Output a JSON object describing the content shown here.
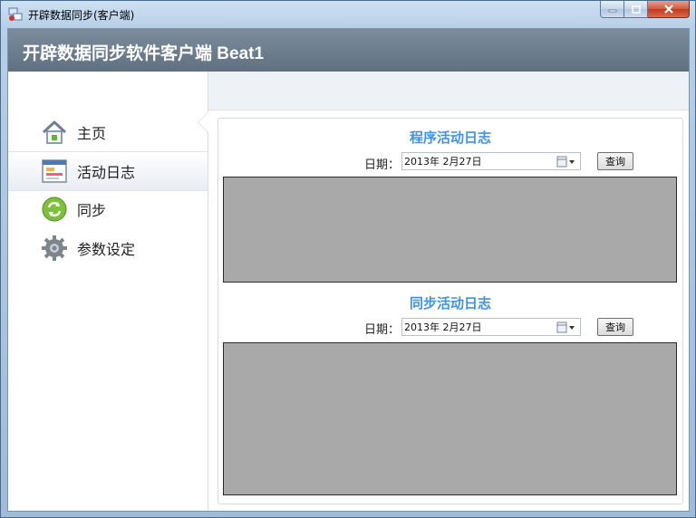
{
  "window": {
    "title": "开辟数据同步(客户端)",
    "minimize_label": "",
    "maximize_label": "",
    "close_label": ""
  },
  "header": {
    "title": "开辟数据同步软件客户端 Beat1"
  },
  "sidebar": {
    "items": [
      {
        "label": "主页",
        "icon": "home-icon"
      },
      {
        "label": "活动日志",
        "icon": "log-icon",
        "active": true
      },
      {
        "label": "同步",
        "icon": "sync-icon"
      },
      {
        "label": "参数设定",
        "icon": "gear-icon"
      }
    ]
  },
  "program_log": {
    "title": "程序活动日志",
    "date_label": "日期：",
    "date_value": "2013年  2月27日",
    "query_label": "查询"
  },
  "sync_log": {
    "title": "同步活动日志",
    "date_label": "日期：",
    "date_value": "2013年  2月27日",
    "query_label": "查询"
  },
  "colors": {
    "accent_title": "#3e93e6",
    "header_bg": "#6b7b8b",
    "log_box_bg": "#a9a9a9"
  }
}
